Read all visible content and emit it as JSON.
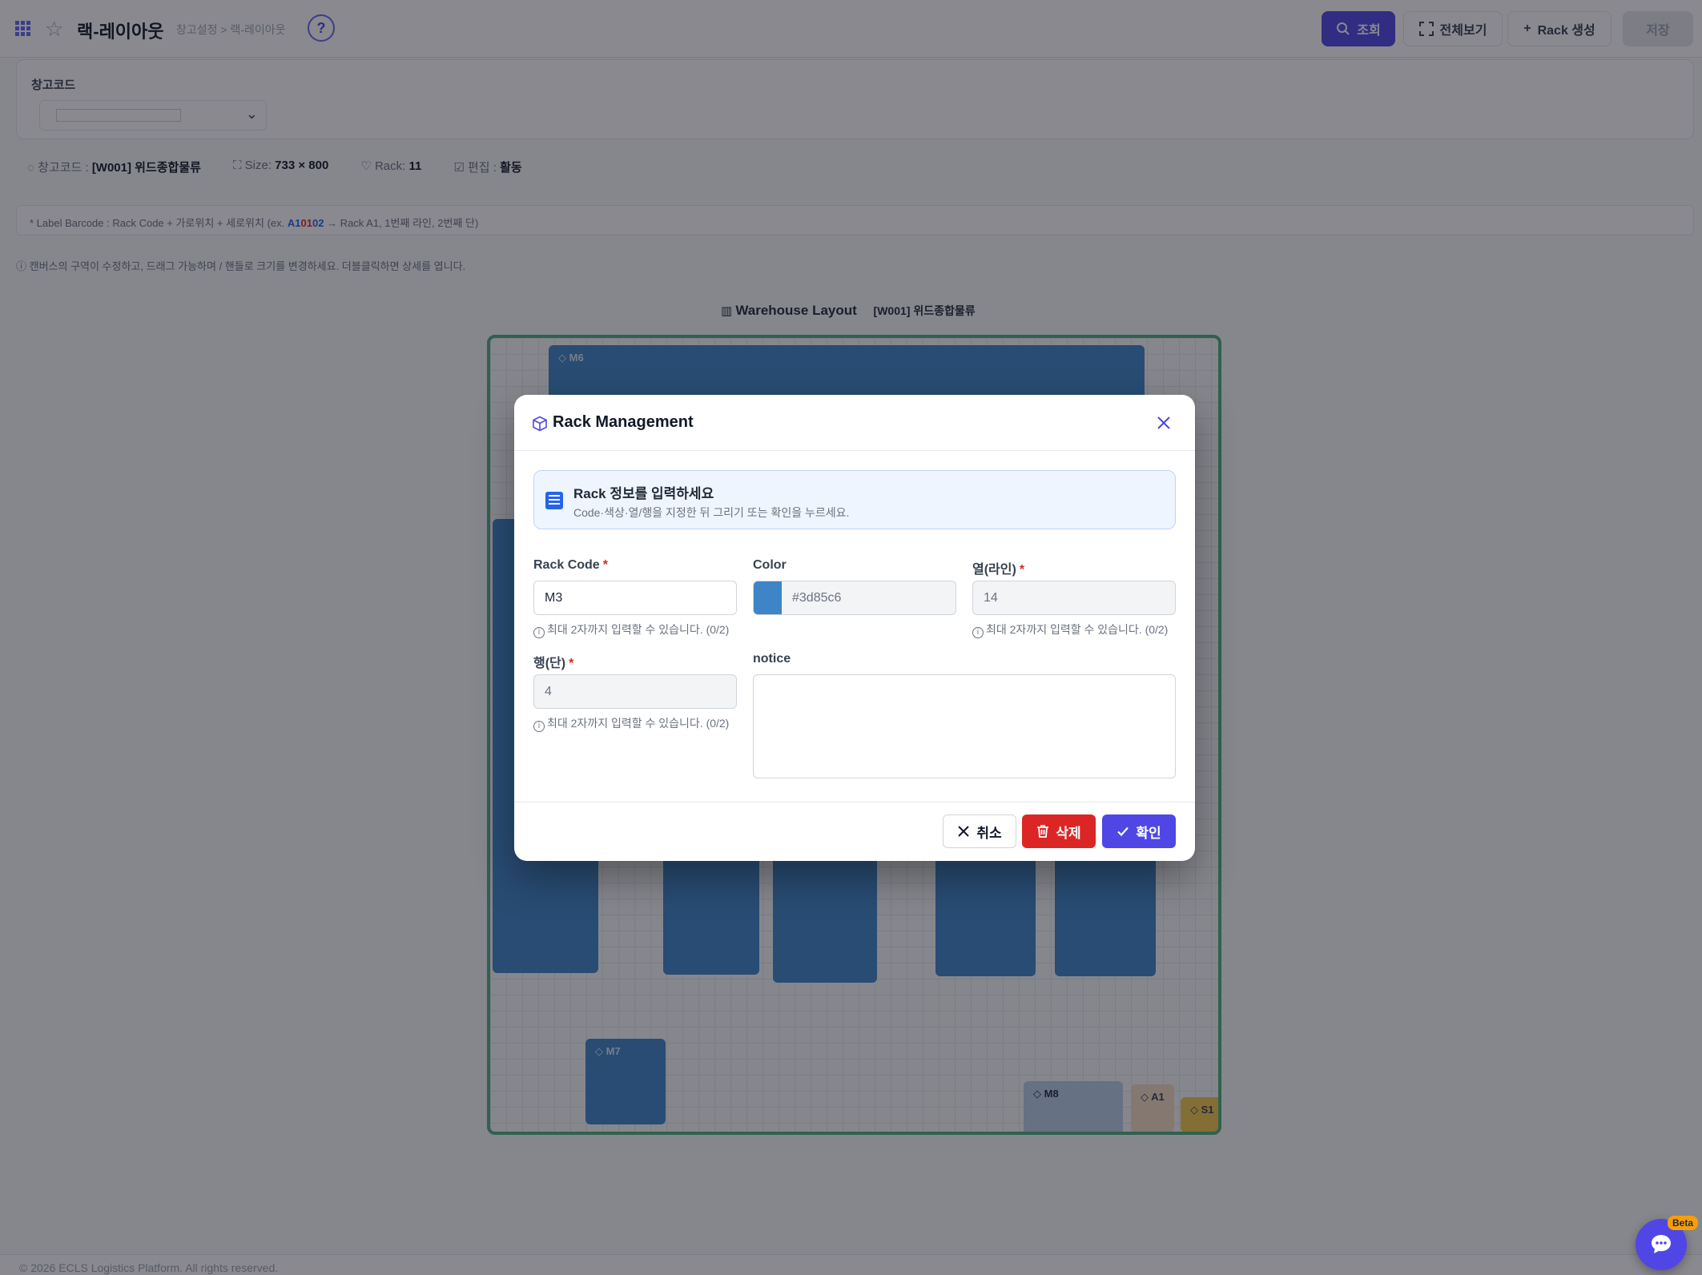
{
  "header": {
    "title": "랙-레이아웃",
    "breadcrumb": "창고설정 > 랙-레이아웃",
    "help": "?",
    "search_label": "조회",
    "fullscreen_label": "전체보기",
    "create_rack_label": "Rack 생성",
    "save_label": "저장"
  },
  "filter": {
    "label": "창고코드"
  },
  "info": {
    "warehouse_label": "창고코드 :",
    "warehouse_value": "[W001] 위드종합물류",
    "size_label": "Size:",
    "size_value": "733 × 800",
    "rack_label": "Rack:",
    "rack_value": "11",
    "edit_label": "편집 :",
    "edit_value": "활동"
  },
  "label_note": {
    "prefix": "* Label Barcode : Rack Code + 가로위치 + 세로위치 (ex.",
    "example_a": "A1",
    "example_mid": "01",
    "example_b": "02",
    "suffix": "→ Rack A1, 1번째 라인, 2번째 단)"
  },
  "help_text": "ⓘ 캔버스의 구역이 수정하고, 드래그 가능하며 / 핸들로 크기를 변경하세요. 더블클릭하면 상세를 엽니다.",
  "layout": {
    "title": "Warehouse Layout",
    "warehouse": "[W001] 위드종합물류",
    "racks": {
      "m6": "M6",
      "m7": "M7",
      "m8": "M8",
      "a1": "A1",
      "s1": "S1"
    }
  },
  "footer": {
    "copyright": "© 2026 ECLS Logistics Platform. All rights reserved."
  },
  "chat": {
    "badge": "Beta"
  },
  "modal": {
    "title": "Rack Management",
    "banner_title": "Rack 정보를 입력하세요",
    "banner_sub": "Code·색상·열/행을 지정한 뒤 그리기 또는 확인을 누르세요.",
    "rack_code_label": "Rack Code",
    "rack_code_value": "M3",
    "rack_code_hint": "최대 2자까지 입력할 수 있습니다. (0/2)",
    "color_label": "Color",
    "color_value": "#3d85c6",
    "column_label": "열(라인)",
    "column_value": "14",
    "column_hint": "최대 2자까지 입력할 수 있습니다. (0/2)",
    "row_label": "행(단)",
    "row_value": "4",
    "row_hint": "최대 2자까지 입력할 수 있습니다. (0/2)",
    "notice_label": "notice",
    "notice_value": "",
    "required_mark": "*",
    "cancel_label": "취소",
    "delete_label": "삭제",
    "confirm_label": "확인"
  },
  "colors": {
    "accent": "#4f46e5",
    "danger": "#dc2626",
    "rack_blue": "#3d85c6",
    "canvas_border": "#4caf7d"
  }
}
